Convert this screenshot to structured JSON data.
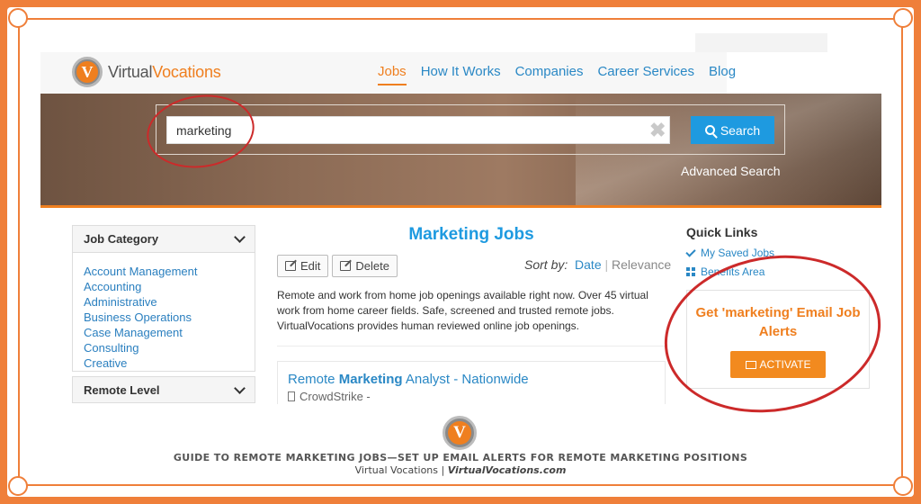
{
  "header": {
    "logo_part1": "Virtual",
    "logo_part2": "Vocations",
    "logo_letter": "V",
    "nav": [
      "Jobs",
      "How It Works",
      "Companies",
      "Career Services",
      "Blog"
    ]
  },
  "search": {
    "value": "marketing",
    "button_label": "Search",
    "advanced_label": "Advanced Search"
  },
  "sidebar": {
    "job_category_title": "Job Category",
    "categories": [
      "Account Management",
      "Accounting",
      "Administrative",
      "Business Operations",
      "Case Management",
      "Consulting",
      "Creative"
    ],
    "remote_level_title": "Remote Level"
  },
  "main": {
    "title": "Marketing Jobs",
    "edit_label": "Edit",
    "delete_label": "Delete",
    "sort_label": "Sort by:",
    "sort_date": "Date",
    "sort_sep": "|",
    "sort_relevance": "Relevance",
    "description": "Remote and work from home job openings available right now. Over 45 virtual work from home career fields. Safe, screened and trusted remote jobs. VirtualVocations provides human reviewed online job openings.",
    "job": {
      "title_pre": "Remote ",
      "title_bold": "Marketing",
      "title_post": " Analyst - Nationwide",
      "company": "CrowdStrike -"
    }
  },
  "quick_links": {
    "title": "Quick Links",
    "saved_jobs": "My Saved Jobs",
    "benefits": "Benefits Area",
    "alert_text": "Get 'marketing' Email Job Alerts",
    "activate_label": "ACTIVATE"
  },
  "footer": {
    "logo_letter": "V",
    "line1": "GUIDE TO REMOTE MARKETING JOBS—SET UP EMAIL ALERTS FOR REMOTE MARKETING POSITIONS",
    "line2_pre": "Virtual Vocations | ",
    "line2_site": "VirtualVocations.com"
  },
  "colors": {
    "frame_orange": "#ef7f3a",
    "brand_orange": "#ef7f1f",
    "link_blue": "#2a88c5",
    "button_blue": "#1e9ae0",
    "annotation_red": "#cc2a2a"
  }
}
